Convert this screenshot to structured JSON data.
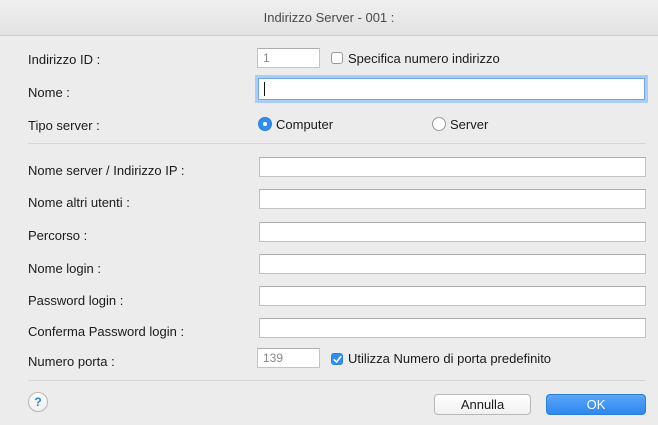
{
  "window": {
    "title": "Indirizzo Server - 001 :"
  },
  "form": {
    "address_id": {
      "label": "Indirizzo ID :",
      "value": "1",
      "checkbox_label": "Specifica numero indirizzo",
      "checkbox_checked": false
    },
    "name": {
      "label": "Nome :",
      "value": ""
    },
    "server_type": {
      "label": "Tipo server :",
      "options": [
        "Computer",
        "Server"
      ],
      "selected": "Computer"
    },
    "server_name": {
      "label": "Nome server / Indirizzo IP :",
      "value": ""
    },
    "other_users": {
      "label": "Nome altri utenti :",
      "value": ""
    },
    "path": {
      "label": "Percorso :",
      "value": ""
    },
    "login_name": {
      "label": "Nome login :",
      "value": ""
    },
    "login_password": {
      "label": "Password login :",
      "value": ""
    },
    "confirm_password": {
      "label": "Conferma Password login :",
      "value": ""
    },
    "port": {
      "label": "Numero porta :",
      "value": "139",
      "checkbox_label": "Utilizza Numero di porta predefinito",
      "checkbox_checked": true
    }
  },
  "footer": {
    "help": "?",
    "cancel": "Annulla",
    "ok": "OK"
  },
  "colors": {
    "accent": "#2f8ef1",
    "background": "#ececec"
  }
}
